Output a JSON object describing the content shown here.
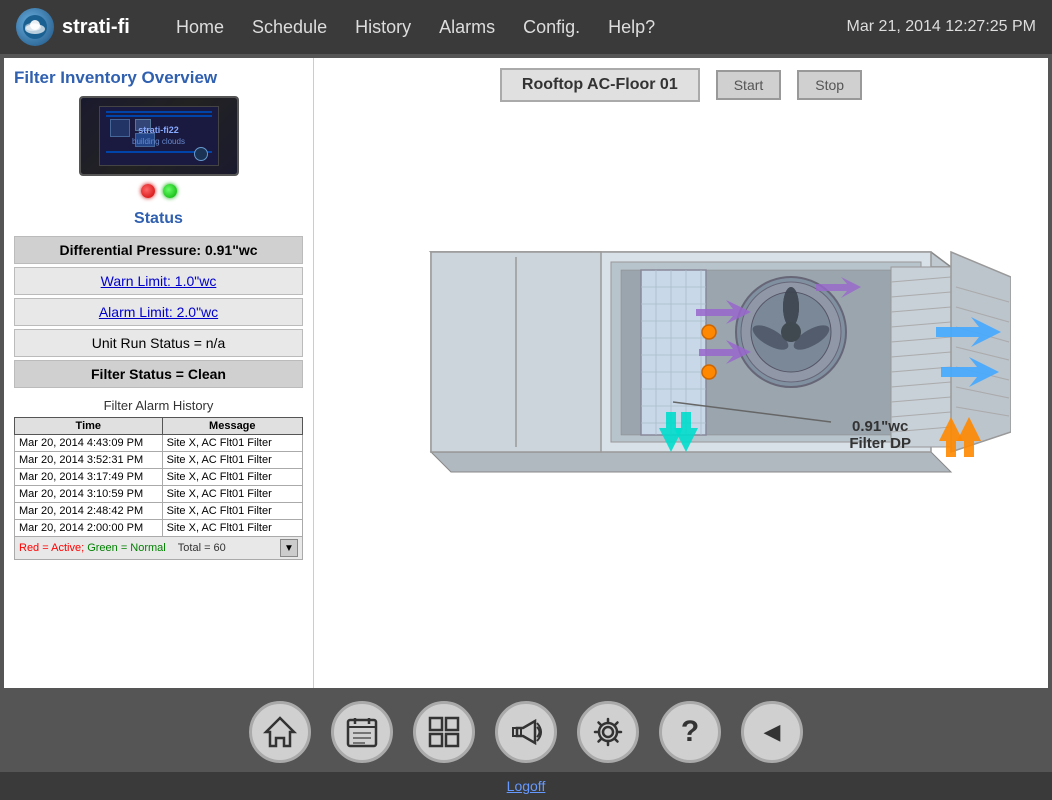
{
  "app": {
    "logo_text": "strati-fi",
    "datetime": "Mar 21, 2014  12:27:25 PM"
  },
  "nav": {
    "items": [
      {
        "label": "Home",
        "id": "home"
      },
      {
        "label": "Schedule",
        "id": "schedule"
      },
      {
        "label": "History",
        "id": "history"
      },
      {
        "label": "Alarms",
        "id": "alarms"
      },
      {
        "label": "Config.",
        "id": "config"
      },
      {
        "label": "Help?",
        "id": "help"
      }
    ]
  },
  "page": {
    "title": "Filter Inventory Overview"
  },
  "device": {
    "name": "strati-fi22",
    "subtitle": "building clouds"
  },
  "status": {
    "title": "Status",
    "differential_pressure_label": "Differential Pressure:",
    "differential_pressure_value": "0.91\"wc",
    "warn_limit": "Warn Limit: 1.0\"wc",
    "alarm_limit": "Alarm Limit: 2.0\"wc",
    "unit_run_status": "Unit Run Status = n/a",
    "filter_status": "Filter Status = Clean"
  },
  "alarm_history": {
    "title": "Filter Alarm History",
    "columns": [
      "Time",
      "Message"
    ],
    "rows": [
      {
        "time": "Mar 20, 2014 4:43:09 PM",
        "message": "Site X, AC Flt01 Filter"
      },
      {
        "time": "Mar 20, 2014 3:52:31 PM",
        "message": "Site X, AC Flt01 Filter"
      },
      {
        "time": "Mar 20, 2014 3:17:49 PM",
        "message": "Site X, AC Flt01 Filter"
      },
      {
        "time": "Mar 20, 2014 3:10:59 PM",
        "message": "Site X, AC Flt01 Filter"
      },
      {
        "time": "Mar 20, 2014 2:48:42 PM",
        "message": "Site X, AC Flt01 Filter"
      },
      {
        "time": "Mar 20, 2014 2:00:00 PM",
        "message": "Site X, AC Flt01 Filter"
      }
    ],
    "footer_red": "Red = Active;",
    "footer_green": "Green = Normal",
    "footer_total": "Total = 60"
  },
  "ac_unit": {
    "name": "Rooftop AC-Floor 01",
    "start_btn": "Start",
    "stop_btn": "Stop"
  },
  "annotation": {
    "dp_value": "0.91\"wc",
    "dp_label": "Filter DP"
  },
  "bottom_nav": [
    {
      "id": "home-btn",
      "icon": "🏠"
    },
    {
      "id": "schedule-btn",
      "icon": "📋"
    },
    {
      "id": "grid-btn",
      "icon": "⊞"
    },
    {
      "id": "alarm-btn",
      "icon": "📢"
    },
    {
      "id": "config-btn",
      "icon": "⚙"
    },
    {
      "id": "help-btn",
      "icon": "?"
    },
    {
      "id": "back-btn",
      "icon": "◀"
    }
  ],
  "footer": {
    "logoff_label": "Logoff",
    "logoff_href": "#"
  }
}
